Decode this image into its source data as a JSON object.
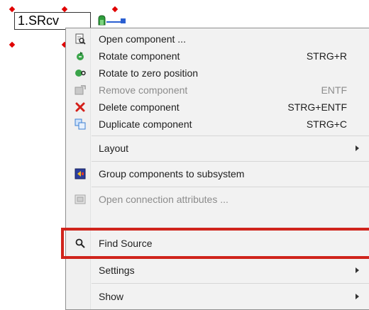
{
  "component": {
    "label": "1.SRcv"
  },
  "menu": {
    "items": [
      {
        "label": "Open component ...",
        "shortcut": "",
        "icon": "open-document-icon",
        "disabled": false
      },
      {
        "label": "Rotate component",
        "shortcut": "STRG+R",
        "icon": "rotate-icon",
        "disabled": false
      },
      {
        "label": "Rotate to zero position",
        "shortcut": "",
        "icon": "rotate-zero-icon",
        "disabled": false
      },
      {
        "label": "Remove component",
        "shortcut": "ENTF",
        "icon": "remove-icon",
        "disabled": true
      },
      {
        "label": "Delete component",
        "shortcut": "STRG+ENTF",
        "icon": "delete-x-icon",
        "disabled": false
      },
      {
        "label": "Duplicate component",
        "shortcut": "STRG+C",
        "icon": "duplicate-icon",
        "disabled": false
      },
      {
        "label": "Layout",
        "shortcut": "",
        "icon": "",
        "disabled": false,
        "submenu": true
      },
      {
        "label": "Group components to subsystem",
        "shortcut": "",
        "icon": "group-subsystem-icon",
        "disabled": false
      },
      {
        "label": "Open connection attributes ...",
        "shortcut": "",
        "icon": "connection-attributes-icon",
        "disabled": true
      },
      {
        "label": "Find Source",
        "shortcut": "",
        "icon": "magnifier-icon",
        "disabled": false,
        "highlighted": true
      },
      {
        "label": "Settings",
        "shortcut": "",
        "icon": "",
        "disabled": false,
        "submenu": true
      },
      {
        "label": "Show",
        "shortcut": "",
        "icon": "",
        "disabled": false,
        "submenu": true
      }
    ]
  },
  "colors": {
    "highlight": "#d0241c",
    "selection_handle": "#e00000",
    "port": "#2b5fd1"
  }
}
